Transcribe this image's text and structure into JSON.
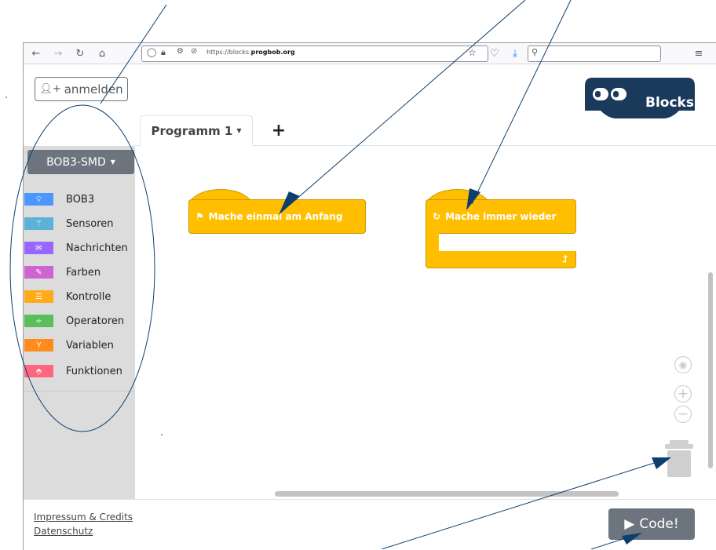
{
  "browser": {
    "url_prefix": "https://blocks.",
    "url_domain": "progbob.org",
    "icons": [
      "back-icon",
      "forward-icon",
      "reload-icon",
      "home-icon",
      "shield-icon",
      "lock-icon",
      "permissions-icon",
      "star-icon",
      "pocket-icon",
      "download-icon",
      "search-icon",
      "menu-icon"
    ]
  },
  "header": {
    "login_label": "anmelden",
    "logo_text": "Blocks"
  },
  "tabs": [
    {
      "label": "Programm 1",
      "active": true
    },
    {
      "label": "+"
    }
  ],
  "sidebar": {
    "device": "BOB3-SMD",
    "categories": [
      {
        "label": "BOB3",
        "color": "#4c97ff",
        "icon": "bulb-icon"
      },
      {
        "label": "Sensoren",
        "color": "#5cb1d6",
        "icon": "magic-wand-icon"
      },
      {
        "label": "Nachrichten",
        "color": "#9966ff",
        "icon": "envelope-icon"
      },
      {
        "label": "Farben",
        "color": "#cf63cf",
        "icon": "brush-icon"
      },
      {
        "label": "Kontrolle",
        "color": "#ffab19",
        "icon": "signpost-icon"
      },
      {
        "label": "Operatoren",
        "color": "#59c059",
        "icon": "divide-icon"
      },
      {
        "label": "Variablen",
        "color": "#ff8c1a",
        "icon": "sprout-icon"
      },
      {
        "label": "Funktionen",
        "color": "#ff6680",
        "icon": "function-icon"
      }
    ]
  },
  "blocks": {
    "start_block": "Mache einmal am Anfang",
    "loop_block": "Mache immer wieder"
  },
  "footer": {
    "impressum": "Impressum & Credits",
    "datenschutz": "Datenschutz",
    "code_label": "Code!"
  },
  "colors": {
    "block": "#ffbf00",
    "button": "#6c757d",
    "logo_bg": "#1a3a5c",
    "annotation": "#0d3f6e"
  }
}
